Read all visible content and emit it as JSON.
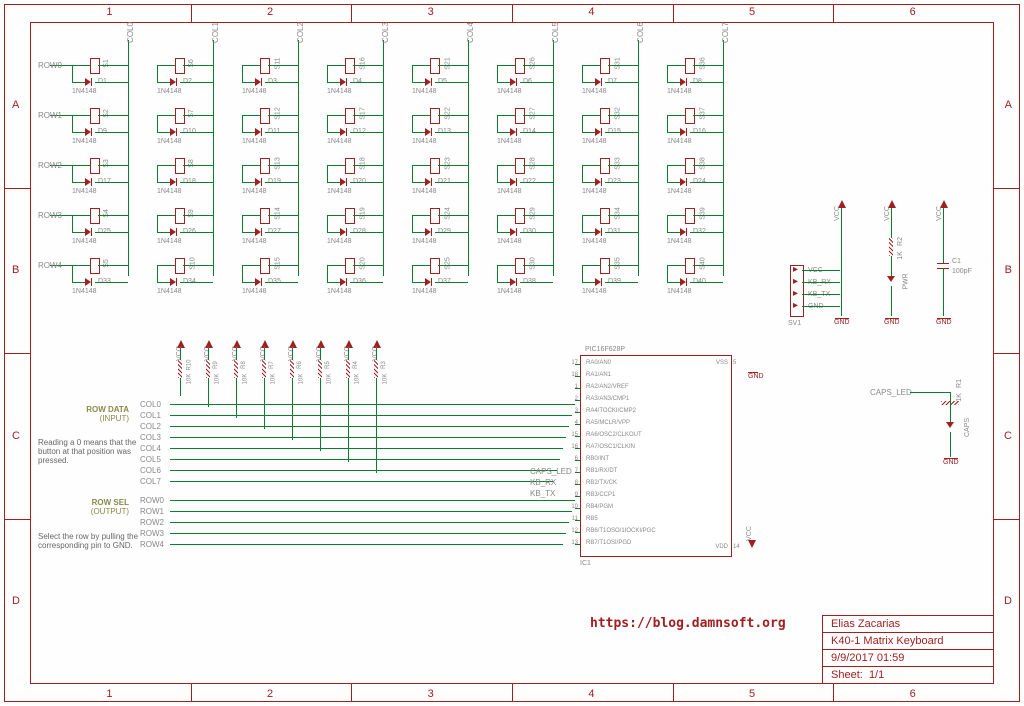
{
  "ruler_cols": [
    "1",
    "2",
    "3",
    "4",
    "5",
    "6"
  ],
  "ruler_rows": [
    "A",
    "B",
    "C",
    "D"
  ],
  "matrix": {
    "rows": [
      "ROW0",
      "ROW1",
      "ROW2",
      "ROW3",
      "ROW4"
    ],
    "cols": [
      "COL0",
      "COL1",
      "COL2",
      "COL3",
      "COL4",
      "COL5",
      "COL6",
      "COL7"
    ],
    "diode_type": "1N4148",
    "switches": [
      [
        "S1",
        "S6",
        "S11",
        "S16",
        "S21",
        "S26",
        "S31",
        "S36"
      ],
      [
        "S2",
        "S7",
        "S12",
        "S17",
        "S22",
        "S27",
        "S32",
        "S37"
      ],
      [
        "S3",
        "S8",
        "S13",
        "S18",
        "S23",
        "S28",
        "S33",
        "S38"
      ],
      [
        "S4",
        "S9",
        "S14",
        "S19",
        "S24",
        "S29",
        "S34",
        "S39"
      ],
      [
        "S5",
        "S10",
        "S15",
        "S20",
        "S25",
        "S30",
        "S35",
        "S40"
      ]
    ],
    "diodes": [
      [
        "D1",
        "D2",
        "D3",
        "D4",
        "D5",
        "D6",
        "D7",
        "D8"
      ],
      [
        "D9",
        "D10",
        "D11",
        "D12",
        "D13",
        "D14",
        "D15",
        "D16"
      ],
      [
        "D17",
        "D18",
        "D19",
        "D20",
        "D21",
        "D22",
        "D23",
        "D24"
      ],
      [
        "D25",
        "D26",
        "D27",
        "D28",
        "D29",
        "D30",
        "D31",
        "D32"
      ],
      [
        "D33",
        "D34",
        "D35",
        "D36",
        "D37",
        "D38",
        "D39",
        "D40"
      ]
    ]
  },
  "notes": {
    "row_data_title": "ROW DATA",
    "row_data_sub": "(INPUT)",
    "row_data_text": "Reading a 0 means that the button at that position was pressed.",
    "row_sel_title": "ROW SEL",
    "row_sel_sub": "(OUTPUT)",
    "row_sel_text": "Select the row by pulling the corresponding pin to GND."
  },
  "bus_cols": [
    "COL0",
    "COL1",
    "COL2",
    "COL3",
    "COL4",
    "COL5",
    "COL6",
    "COL7"
  ],
  "bus_rows": [
    "ROW0",
    "ROW1",
    "ROW2",
    "ROW3",
    "ROW4"
  ],
  "pullups": {
    "refs": [
      "R10",
      "R9",
      "R8",
      "R7",
      "R6",
      "R5",
      "R4",
      "R3"
    ],
    "value": "10K",
    "rail": "VCC"
  },
  "ic": {
    "ref": "IC1",
    "part": "PIC16F628P",
    "left_pins": [
      {
        "n": "17",
        "name": "RA0/AN0"
      },
      {
        "n": "18",
        "name": "RA1/AN1"
      },
      {
        "n": "1",
        "name": "RA2/AN2/VREF"
      },
      {
        "n": "2",
        "name": "RA3/AN3/CMP1"
      },
      {
        "n": "3",
        "name": "RA4/TOCKI/CMP2"
      },
      {
        "n": "4",
        "name": "RA5/MCLR/VPP"
      },
      {
        "n": "15",
        "name": "RA6/OSC2/CLKOUT"
      },
      {
        "n": "16",
        "name": "RA7/OSC1/CLKIN"
      },
      {
        "n": "6",
        "name": "RB0/INT"
      },
      {
        "n": "7",
        "name": "RB1/RX/DT"
      },
      {
        "n": "8",
        "name": "RB2/TX/CK"
      },
      {
        "n": "9",
        "name": "RB3/CCP1"
      },
      {
        "n": "10",
        "name": "RB4/PGM"
      },
      {
        "n": "11",
        "name": "RB5"
      },
      {
        "n": "12",
        "name": "RB6/T1OSO/1IOCKI/PGC"
      },
      {
        "n": "13",
        "name": "RB7/T1OSI/PGD"
      }
    ],
    "right_pins": [
      {
        "n": "5",
        "name": "VSS"
      },
      {
        "n": "14",
        "name": "VDD"
      }
    ],
    "nets_left_extra": [
      "CAPS_LED",
      "KB_RX",
      "KB_TX"
    ]
  },
  "connector": {
    "ref": "SV1",
    "pins": [
      "VCC",
      "KB_RX",
      "KB_TX",
      "GND"
    ]
  },
  "power_led": {
    "res_ref": "R2",
    "res_val": "1K",
    "led_ref": "PWR",
    "rail_top": "VCC",
    "rail_bot": "GND"
  },
  "decoupling": {
    "ref": "C1",
    "val": "100pF",
    "rail_top": "VCC",
    "rail_bot": "GND"
  },
  "caps_led": {
    "net": "CAPS_LED",
    "res_ref": "R1",
    "res_val": "1K",
    "led_ref": "CAPS",
    "rail_bot": "GND"
  },
  "gnd_label": "GND",
  "vcc_label": "VCC",
  "url": "https://blog.damnsoft.org",
  "title_block": {
    "author": "Elias Zacarias",
    "title": "K40-1 Matrix Keyboard",
    "date": "9/9/2017 01:59",
    "sheet_label": "Sheet:",
    "sheet": "1/1"
  }
}
